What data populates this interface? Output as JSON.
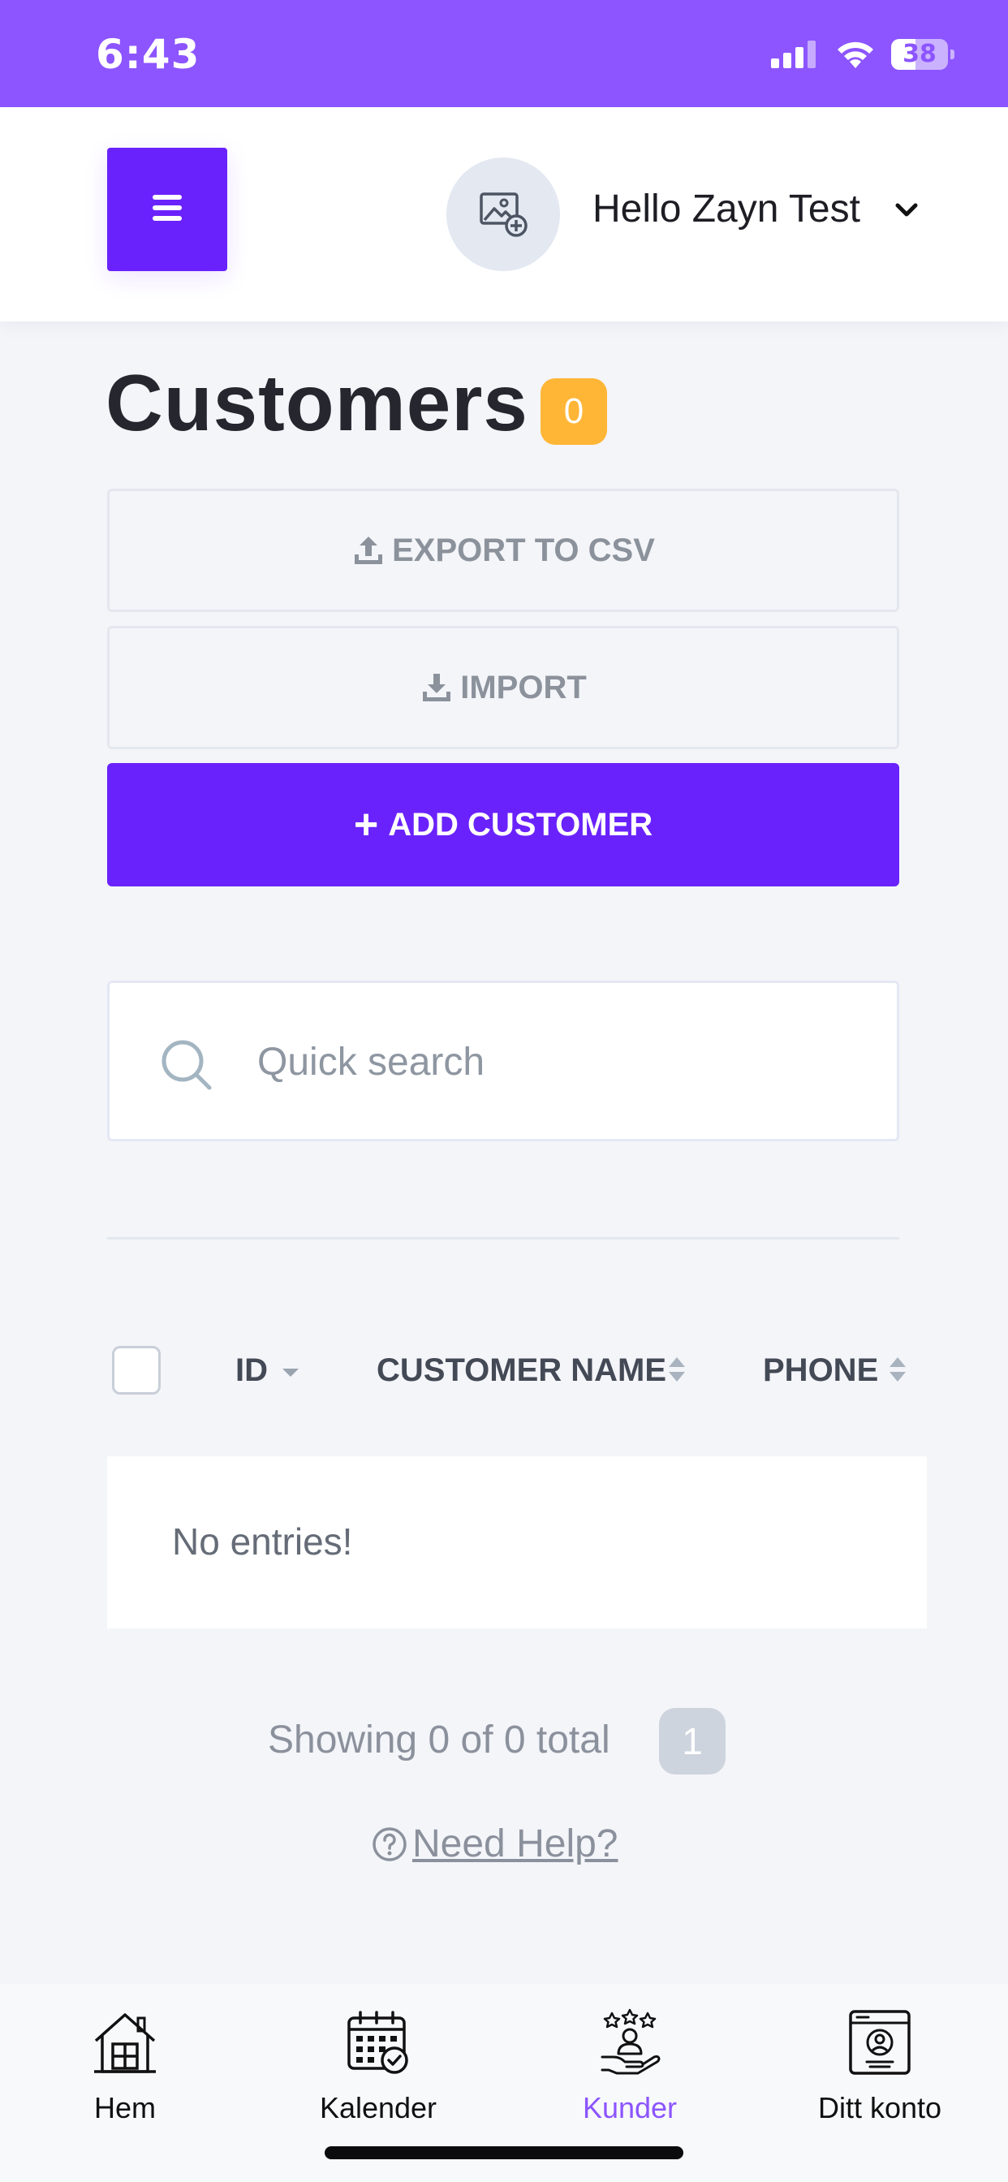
{
  "status_bar": {
    "time": "6:43",
    "battery_percent": "38"
  },
  "header": {
    "greeting": "Hello Zayn Test",
    "menu_icon": "hamburger-icon",
    "avatar_icon": "add-image-icon",
    "dropdown_icon": "chevron-down-icon"
  },
  "page": {
    "title": "Customers",
    "count": "0"
  },
  "actions": {
    "export_label": "EXPORT TO CSV",
    "import_label": "IMPORT",
    "add_label": "ADD CUSTOMER"
  },
  "search": {
    "placeholder": "Quick search"
  },
  "table": {
    "columns": [
      "ID",
      "CUSTOMER NAME",
      "PHONE"
    ],
    "empty_message": "No entries!"
  },
  "pagination": {
    "summary": "Showing 0 of 0 total",
    "current_page": "1"
  },
  "help": {
    "label": " Need Help?"
  },
  "tab_bar": {
    "items": [
      {
        "label": "Hem",
        "icon": "house-icon"
      },
      {
        "label": "Kalender",
        "icon": "calendar-icon"
      },
      {
        "label": "Kunder",
        "icon": "customers-icon"
      },
      {
        "label": "Ditt konto",
        "icon": "account-card-icon"
      }
    ],
    "active_index": 2
  },
  "colors": {
    "status_bar": "#8c55ff",
    "primary": "#6a22fc",
    "count_badge": "#ffb637",
    "active_tab": "#8c55ff",
    "background": "#f4f5f9"
  }
}
